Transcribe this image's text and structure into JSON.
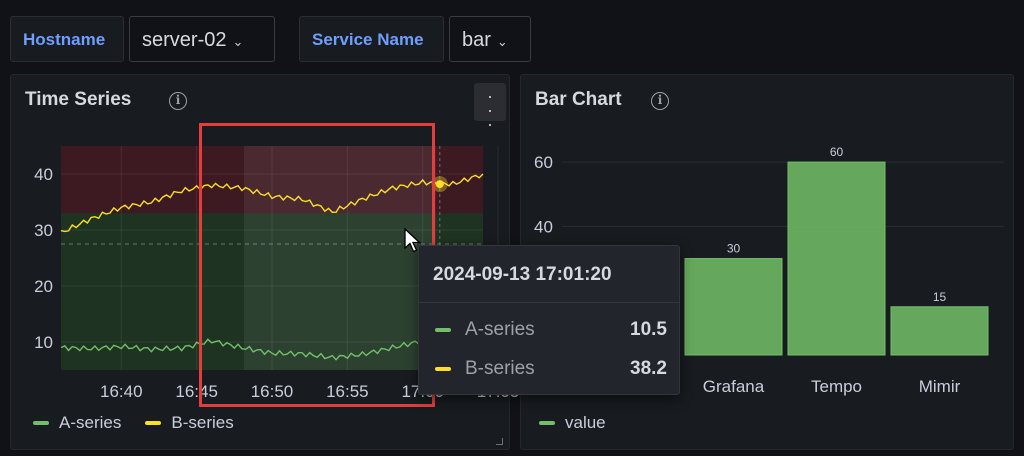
{
  "variables": {
    "hostname": {
      "label": "Hostname",
      "value": "server-02"
    },
    "service": {
      "label": "Service Name",
      "value": "bar"
    }
  },
  "timeseries_panel": {
    "title": "Time Series",
    "menu_icon": "kebab-menu-icon",
    "info_icon": "info-circle-icon",
    "x_ticks": [
      "16:40",
      "16:45",
      "16:50",
      "16:55",
      "17:00",
      "17:05"
    ],
    "y_ticks": [
      "10",
      "20",
      "30",
      "40"
    ],
    "legend": [
      {
        "name": "A-series",
        "color": "#73bf69"
      },
      {
        "name": "B-series",
        "color": "#fade2a"
      }
    ]
  },
  "barchart_panel": {
    "title": "Bar Chart",
    "info_icon": "info-circle-icon",
    "y_ticks": [
      "40",
      "60"
    ],
    "legend": [
      {
        "name": "value",
        "color": "#73bf69"
      }
    ]
  },
  "tooltip": {
    "time": "2024-09-13 17:01:20",
    "rows": [
      {
        "name": "A-series",
        "value": "10.5",
        "color": "#73bf69"
      },
      {
        "name": "B-series",
        "value": "38.2",
        "color": "#fade2a"
      }
    ]
  },
  "chart_data": [
    {
      "type": "line",
      "title": "Time Series",
      "x": [
        "16:36",
        "16:38",
        "16:40",
        "16:42",
        "16:44",
        "16:46",
        "16:48",
        "16:50",
        "16:52",
        "16:54",
        "16:56",
        "16:58",
        "17:00",
        "17:02",
        "17:04"
      ],
      "series": [
        {
          "name": "A-series",
          "color": "#73bf69",
          "values": [
            9.0,
            8.8,
            9.2,
            8.7,
            8.9,
            10.2,
            9.0,
            8.0,
            7.9,
            7.2,
            7.8,
            9.0,
            10.2,
            11.0,
            10.8
          ]
        },
        {
          "name": "B-series",
          "color": "#fade2a",
          "values": [
            29.5,
            32.0,
            34.0,
            35.0,
            37.0,
            38.0,
            37.5,
            36.0,
            35.5,
            33.2,
            35.5,
            37.5,
            38.5,
            38.2,
            40.0
          ]
        }
      ],
      "ylim": [
        5,
        45
      ],
      "threshold_regions": [
        {
          "from": 33,
          "to": 45,
          "color": "#c4162a"
        },
        {
          "from": 5,
          "to": 33,
          "color": "#37872d"
        }
      ],
      "grid": true,
      "legend": "bottom-left"
    },
    {
      "type": "bar",
      "title": "Bar Chart",
      "categories": [
        "Grafana",
        "Tempo",
        "Mimir"
      ],
      "series": [
        {
          "name": "value",
          "color": "#73bf69",
          "values": [
            30,
            60,
            15
          ]
        }
      ],
      "ylim": [
        0,
        65
      ],
      "grid": true,
      "legend": "bottom-left"
    }
  ]
}
